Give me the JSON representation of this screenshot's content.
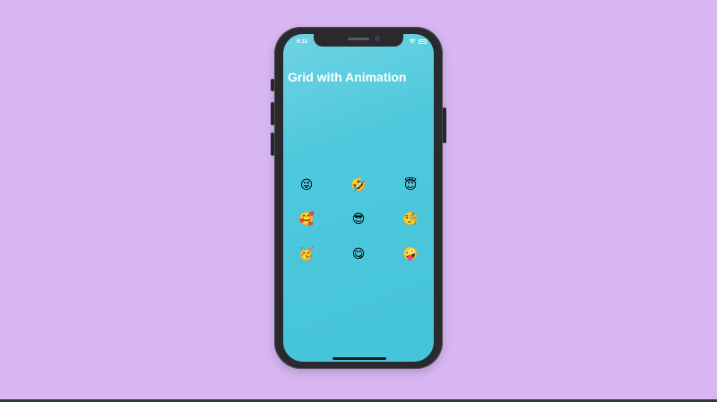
{
  "status_bar": {
    "time": "9:13"
  },
  "screen": {
    "title": "Grid with Animation"
  },
  "emoji_grid": [
    "😜",
    "🤣",
    "😇",
    "🥰",
    "😎",
    "🧐",
    "🥳",
    "😋",
    "🤪"
  ],
  "colors": {
    "background": "#d7b6f2",
    "screen_accent": "#4ec8dc",
    "title_text": "#ffffff"
  }
}
